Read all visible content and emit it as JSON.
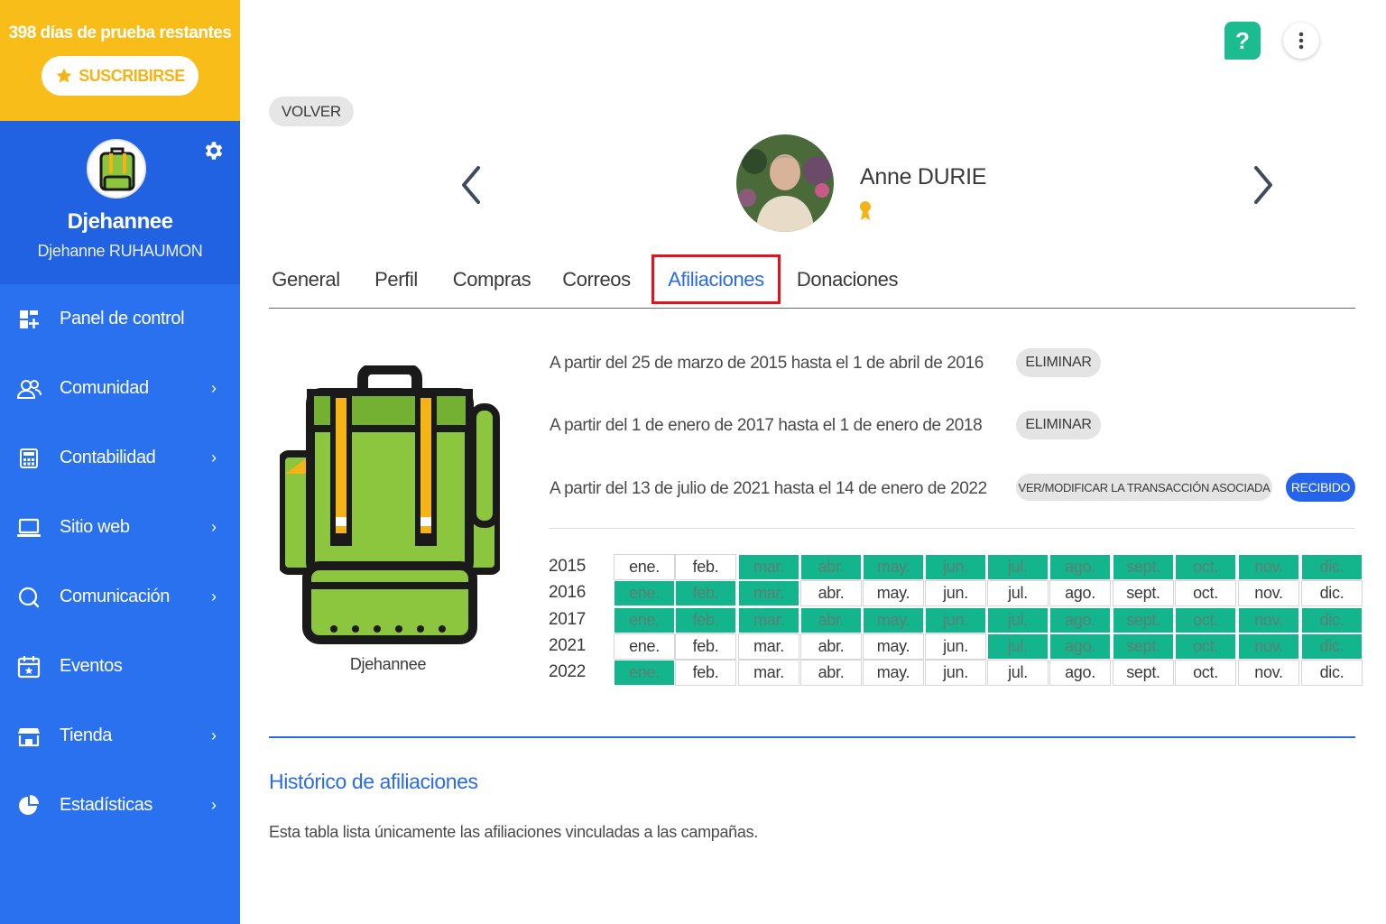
{
  "trial": {
    "text": "398 días de prueba restantes",
    "subscribe_label": "SUSCRIBIRSE"
  },
  "profile": {
    "org_name": "Djehannee",
    "user_name": "Djehanne RUHAUMON"
  },
  "nav": [
    {
      "label": "Panel de control",
      "icon": "dashboard-icon",
      "has_submenu": false
    },
    {
      "label": "Comunidad",
      "icon": "community-icon",
      "has_submenu": true
    },
    {
      "label": "Contabilidad",
      "icon": "calculator-icon",
      "has_submenu": true
    },
    {
      "label": "Sitio web",
      "icon": "laptop-icon",
      "has_submenu": true
    },
    {
      "label": "Comunicación",
      "icon": "chat-icon",
      "has_submenu": true
    },
    {
      "label": "Eventos",
      "icon": "calendar-icon",
      "has_submenu": false
    },
    {
      "label": "Tienda",
      "icon": "store-icon",
      "has_submenu": true
    },
    {
      "label": "Estadísticas",
      "icon": "pie-chart-icon",
      "has_submenu": true
    }
  ],
  "header": {
    "back_label": "VOLVER",
    "member_name": "Anne DURIE",
    "help_label": "?"
  },
  "tabs": [
    {
      "label": "General",
      "active": false
    },
    {
      "label": "Perfil",
      "active": false
    },
    {
      "label": "Compras",
      "active": false
    },
    {
      "label": "Correos",
      "active": false
    },
    {
      "label": "Afiliaciones",
      "active": true
    },
    {
      "label": "Donaciones",
      "active": false
    }
  ],
  "club": {
    "caption": "Djehannee"
  },
  "memberships": [
    {
      "text": "A partir del 25 de marzo de 2015 hasta el 1 de abril de 2016",
      "action": "ELIMINAR"
    },
    {
      "text": "A partir del 1 de enero de 2017 hasta el 1 de enero de 2018",
      "action": "ELIMINAR"
    },
    {
      "text": "A partir del 13 de julio de 2021 hasta el 14 de enero de 2022",
      "action": "VER/MODIFICAR LA TRANSACCIÓN ASOCIADA",
      "status": "RECIBIDO"
    }
  ],
  "calendar": {
    "months": [
      "ene.",
      "feb.",
      "mar.",
      "abr.",
      "may.",
      "jun.",
      "jul.",
      "ago.",
      "sept.",
      "oct.",
      "nov.",
      "dic."
    ],
    "rows": [
      {
        "year": "2015",
        "active": [
          false,
          false,
          true,
          true,
          true,
          true,
          true,
          true,
          true,
          true,
          true,
          true
        ]
      },
      {
        "year": "2016",
        "active": [
          true,
          true,
          true,
          false,
          false,
          false,
          false,
          false,
          false,
          false,
          false,
          false
        ]
      },
      {
        "year": "2017",
        "active": [
          true,
          true,
          true,
          true,
          true,
          true,
          true,
          true,
          true,
          true,
          true,
          true
        ]
      },
      {
        "year": "2021",
        "active": [
          false,
          false,
          false,
          false,
          false,
          false,
          true,
          true,
          true,
          true,
          true,
          true
        ]
      },
      {
        "year": "2022",
        "active": [
          true,
          false,
          false,
          false,
          false,
          false,
          false,
          false,
          false,
          false,
          false,
          false
        ]
      }
    ]
  },
  "history": {
    "title": "Histórico de afiliaciones",
    "description": "Esta tabla lista únicamente las afiliaciones vinculadas a las campañas."
  },
  "colors": {
    "sidebar_blue": "#2a71f0",
    "trial_yellow": "#f9bd1a",
    "accent_blue": "#2a6be6",
    "active_month_green": "#12b58c",
    "help_green": "#1bbc90",
    "tab_highlight_red": "#e0141e"
  }
}
